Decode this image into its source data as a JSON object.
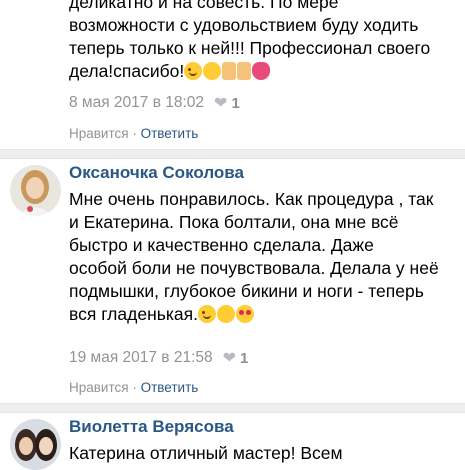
{
  "comments": [
    {
      "author": "",
      "text_lines": [
        "деликатно и на совесть. По мере",
        "возможности с удовольствием буду ходить",
        "теперь только к ней!!! Профессионал своего",
        "дела!спасибо!"
      ],
      "emojis": [
        "wink",
        "grin",
        "thumbs-up",
        "thumbs-up",
        "rose"
      ],
      "date": "8 мая 2017 в 18:02",
      "likes": "1",
      "like_label": "Нравится",
      "reply_label": "Ответить"
    },
    {
      "author": "Оксаночка Соколова",
      "text_lines": [
        "Мне очень понравилось. Как процедура , так",
        "и Екатерина. Пока болтали, она мне всё",
        "быстро и качественно сделала. Даже",
        "особой боли не почувствовала. Делала у неё",
        "подмышки, глубокое бикини и ноги - теперь",
        "вся гладенькая."
      ],
      "emojis": [
        "wink",
        "grin",
        "heart-eyes"
      ],
      "date": "19 мая 2017 в 21:58",
      "likes": "1",
      "like_label": "Нравится",
      "reply_label": "Ответить"
    },
    {
      "author": "Виолетта Верясова",
      "text_lines": [
        "Катерина отличный мастер! Всем"
      ],
      "emojis": [],
      "date": "",
      "likes": "",
      "like_label": "",
      "reply_label": ""
    }
  ],
  "action_separator": " · ",
  "colors": {
    "author": "#2a5885",
    "meta": "#939393",
    "separator": "#edeef0"
  }
}
